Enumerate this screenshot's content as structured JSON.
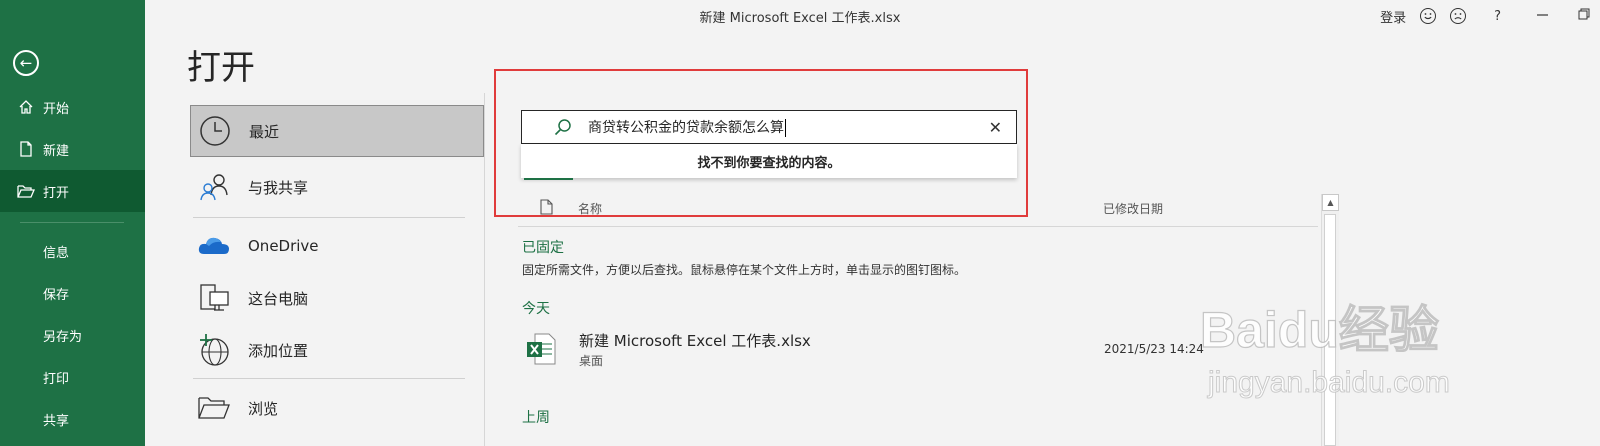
{
  "window": {
    "title": "新建 Microsoft Excel 工作表.xlsx",
    "login_label": "登录",
    "help_label": "?"
  },
  "sidebar": {
    "items": [
      {
        "label": "开始",
        "icon": "home-icon"
      },
      {
        "label": "新建",
        "icon": "new-doc-icon"
      },
      {
        "label": "打开",
        "icon": "open-folder-icon",
        "active": true
      },
      {
        "label": "信息"
      },
      {
        "label": "保存"
      },
      {
        "label": "另存为"
      },
      {
        "label": "打印"
      },
      {
        "label": "共享"
      }
    ]
  },
  "page": {
    "title": "打开"
  },
  "locations": [
    {
      "label": "最近",
      "icon": "clock-icon",
      "selected": true
    },
    {
      "label": "与我共享",
      "icon": "people-icon"
    },
    {
      "label": "OneDrive",
      "icon": "cloud-icon"
    },
    {
      "label": "这台电脑",
      "icon": "computer-icon"
    },
    {
      "label": "添加位置",
      "icon": "add-location-icon"
    },
    {
      "label": "浏览",
      "icon": "folder-icon"
    }
  ],
  "search": {
    "value": "商贷转公积金的贷款余额怎么算",
    "no_results": "找不到你要查找的内容。"
  },
  "file_list": {
    "col_name": "名称",
    "col_modified": "已修改日期",
    "pinned_title": "已固定",
    "pinned_hint": "固定所需文件，方便以后查找。鼠标悬停在某个文件上方时，单击显示的图钉图标。",
    "today_title": "今天",
    "last_week_title": "上周",
    "files": [
      {
        "name": "新建 Microsoft Excel 工作表.xlsx",
        "location": "桌面",
        "modified": "2021/5/23 14:24"
      }
    ]
  },
  "watermark": {
    "main": "Baidu经验",
    "sub": "jingyan.baidu.com"
  },
  "colors": {
    "accent": "#1e7145",
    "highlight_box": "#e03b3b"
  }
}
